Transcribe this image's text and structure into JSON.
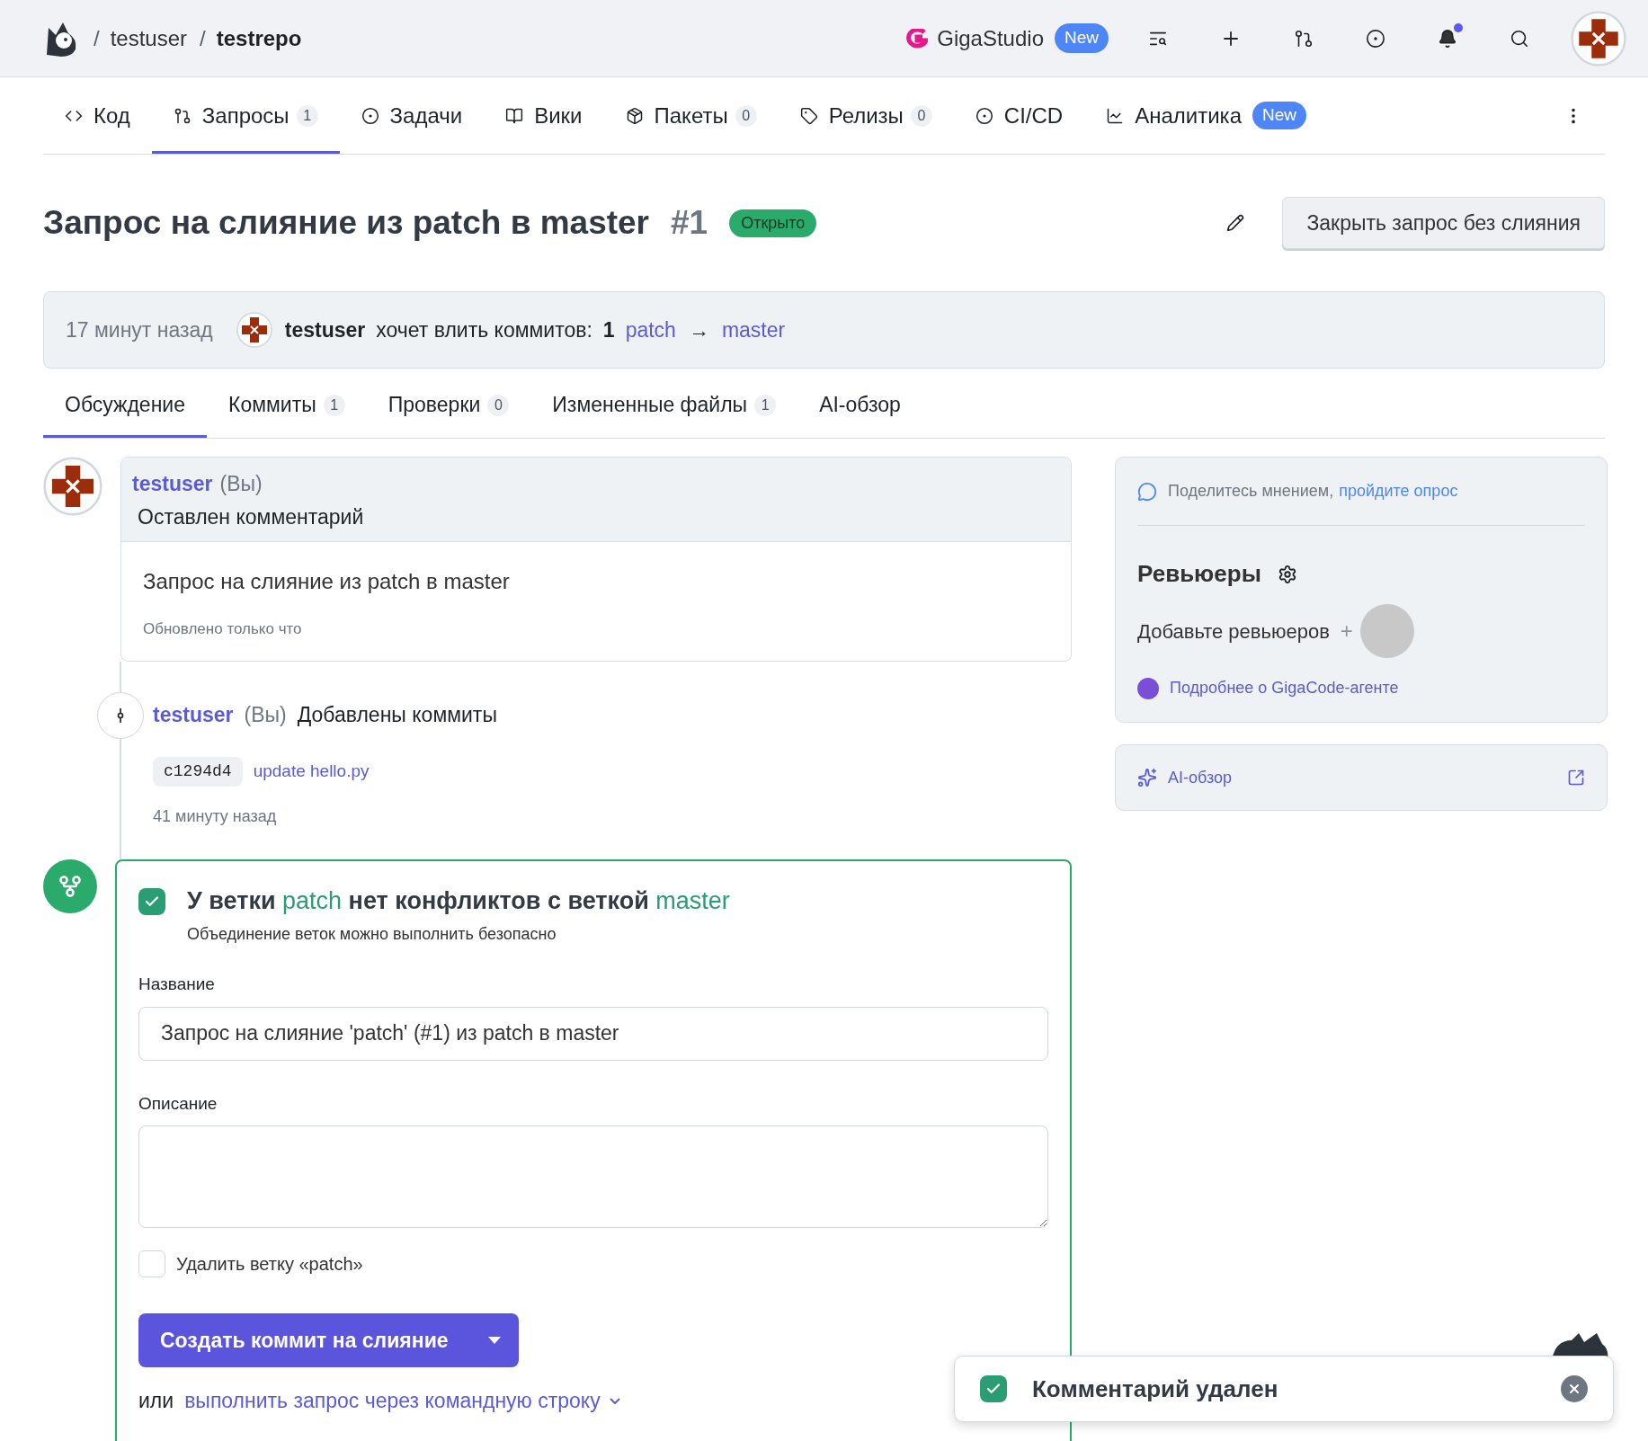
{
  "header": {
    "breadcrumb": [
      {
        "separator": "/",
        "text": "testuser",
        "bold": false
      },
      {
        "separator": "/",
        "text": "testrepo",
        "bold": true
      }
    ],
    "studio": {
      "label": "GigaStudio",
      "badge": "New"
    },
    "notifications_unread": true
  },
  "repo_tabs": [
    {
      "label": "Код",
      "selected": false
    },
    {
      "label": "Запросы",
      "count": "1",
      "selected": true
    },
    {
      "label": "Задачи",
      "selected": false
    },
    {
      "label": "Вики",
      "selected": false
    },
    {
      "label": "Пакеты",
      "count": "0",
      "selected": false
    },
    {
      "label": "Релизы",
      "count": "0",
      "selected": false
    },
    {
      "label": "CI/CD",
      "selected": false
    },
    {
      "label": "Аналитика",
      "badge": "New",
      "selected": false
    }
  ],
  "pr": {
    "title": "Запрос на слияние из patch в master",
    "number": "#1",
    "status": "Открыто",
    "close_button": "Закрыть запрос без слияния"
  },
  "info": {
    "time": "17 минут назад",
    "user": "testuser",
    "text": "хочет влить коммитов:",
    "count": "1",
    "source": "patch",
    "arrow": "→",
    "target": "master"
  },
  "pr_tabs": [
    {
      "label": "Обсуждение",
      "selected": true
    },
    {
      "label": "Коммиты",
      "count": "1",
      "selected": false
    },
    {
      "label": "Проверки",
      "count": "0",
      "selected": false
    },
    {
      "label": "Измененные файлы",
      "count": "1",
      "selected": false
    },
    {
      "label": "AI-обзор",
      "selected": false
    }
  ],
  "comment": {
    "user": "testuser",
    "you": "(Вы)",
    "action": "Оставлен комментарий",
    "body": "Запрос на слияние из patch в master",
    "updated": "Обновлено только что"
  },
  "commit_event": {
    "user": "testuser",
    "you": "(Вы)",
    "action": "Добавлены коммиты",
    "sha": "c1294d4",
    "message": "update hello.py",
    "time": "41 минуту назад"
  },
  "merge": {
    "heading_parts": [
      {
        "text": "У ветки",
        "kind": "plain"
      },
      {
        "text": "patch",
        "kind": "branch"
      },
      {
        "text": "нет конфликтов с веткой",
        "kind": "plain"
      },
      {
        "text": "master",
        "kind": "branch"
      }
    ],
    "subtitle": "Объединение веток можно выполнить безопасно",
    "title_label": "Название",
    "title_value": "Запрос на слияние 'patch' (#1) из patch в master",
    "description_label": "Описание",
    "delete_branch": {
      "label": "Удалить ветку «patch»",
      "checked": false
    },
    "merge_button": "Создать коммит на слияние",
    "alt_prefix": "или",
    "alt_link": "выполнить запрос через командную строку"
  },
  "sidebar": {
    "feedback_text": "Поделитесь мнением,",
    "feedback_link": "пройдите опрос",
    "reviewers_title": "Ревьюеры",
    "add_reviewers": "Добавьте ревьюеров",
    "plus": "+",
    "agent_link": "Подробнее о GigaCode-агенте",
    "ai_review": "AI-обзор"
  },
  "toast": {
    "message": "Комментарий удален"
  }
}
